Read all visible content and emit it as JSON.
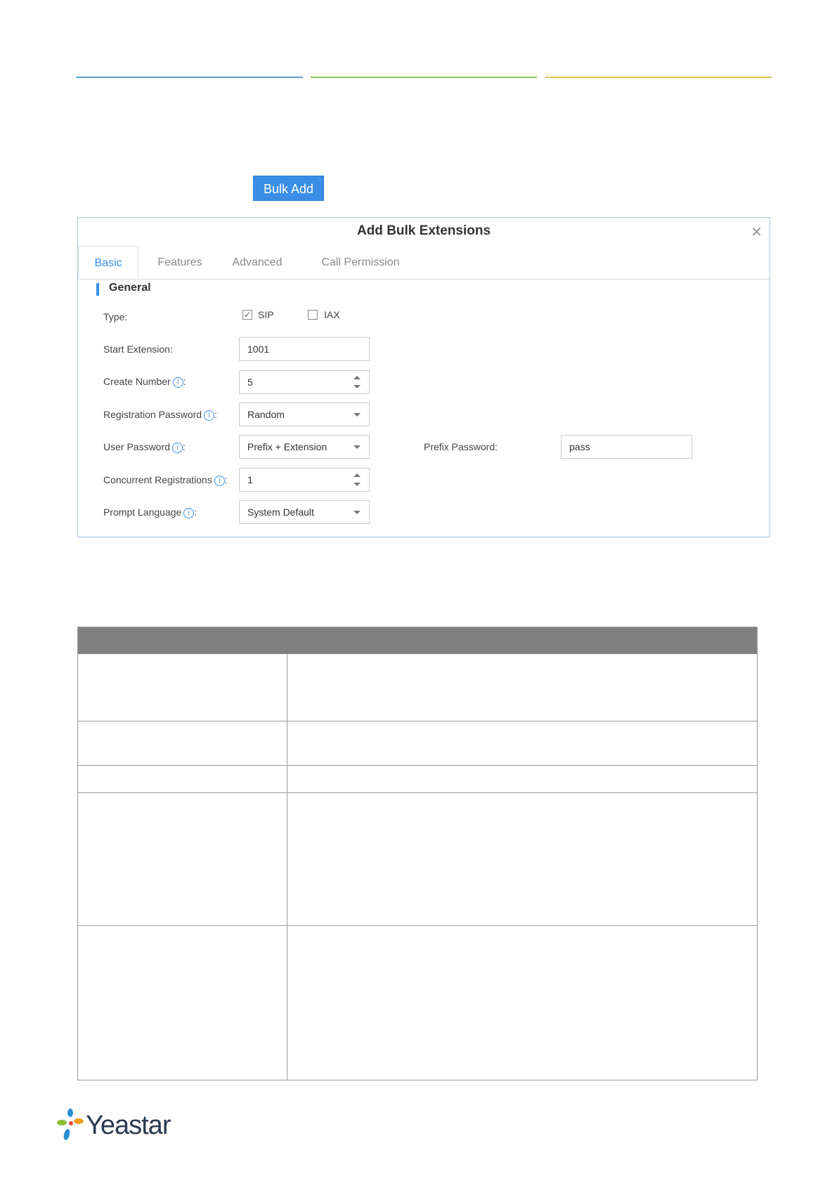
{
  "colors": {
    "accent": "#3a8ee6",
    "line_blue": "#5aa0c8",
    "line_green": "#8cbf4a",
    "line_yellow": "#d4c55a",
    "table_header": "#808080"
  },
  "button": {
    "bulk_add": "Bulk Add"
  },
  "dialog": {
    "title": "Add Bulk Extensions",
    "close_icon": "close-icon",
    "tabs": [
      {
        "label": "Basic",
        "active": true
      },
      {
        "label": "Features",
        "active": false
      },
      {
        "label": "Advanced",
        "active": false
      },
      {
        "label": "Call Permission",
        "active": false
      }
    ],
    "section": "General",
    "type": {
      "label": "Type:",
      "options": [
        {
          "label": "SIP",
          "checked": true
        },
        {
          "label": "IAX",
          "checked": false
        }
      ]
    },
    "fields": {
      "start_extension": {
        "label": "Start Extension:",
        "value": "1001"
      },
      "create_number": {
        "label": "Create Number",
        "suffix": ":",
        "value": "5"
      },
      "registration_password": {
        "label": "Registration Password",
        "suffix": ":",
        "value": "Random"
      },
      "user_password": {
        "label": "User Password",
        "suffix": ":",
        "value": "Prefix + Extension"
      },
      "prefix_password": {
        "label": "Prefix Password:",
        "value": "pass"
      },
      "concurrent_registrations": {
        "label": "Concurrent Registrations",
        "suffix": ":",
        "value": "1"
      },
      "prompt_language": {
        "label": "Prompt Language",
        "suffix": ":",
        "value": "System Default"
      }
    }
  },
  "logo": {
    "text": "Yeastar"
  }
}
